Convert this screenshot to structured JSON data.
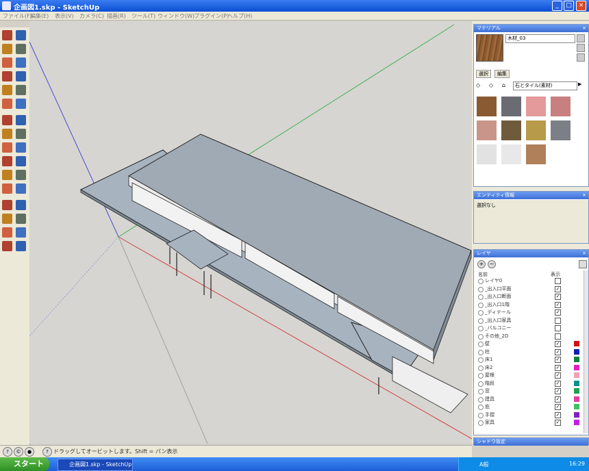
{
  "window": {
    "title": "企画図1.skp - SketchUp",
    "controls": [
      "_",
      "□",
      "×"
    ]
  },
  "menu": [
    "ファイル(F)",
    "編集(E)",
    "表示(V)",
    "カメラ(C)",
    "描画(R)",
    "ツール(T)",
    "ウィンドウ(W)",
    "プラグイン(P)",
    "ヘルプ(H)"
  ],
  "materials_panel": {
    "title": "マテリアル",
    "material_name": "木材_03",
    "tabs": [
      "選択",
      "編集"
    ],
    "category": "石とタイル(素材)",
    "swatch_colors": [
      "#8a5a32",
      "#6b6b74",
      "#e49a9a",
      "#c87f80",
      "#c9958a",
      "#6f5a3c",
      "#b79a4a",
      "#7c7f86",
      "#e2e2e2",
      "#e8e8e8",
      "#b0805a"
    ]
  },
  "entity_panel": {
    "title": "エンティティ情報",
    "value": "選択なし"
  },
  "layers_panel": {
    "title": "レイヤ",
    "col_name": "名前",
    "col_visible": "表示",
    "layers": [
      {
        "name": "レイヤ0",
        "visible": false,
        "color": "#ffffff"
      },
      {
        "name": "_出入口平面",
        "visible": true,
        "color": "#ffffff"
      },
      {
        "name": "_出入口断面",
        "visible": true,
        "color": "#ffffff"
      },
      {
        "name": "_出入口1階",
        "visible": true,
        "color": "#ffffff"
      },
      {
        "name": "_ディテール",
        "visible": true,
        "color": "#ffffff"
      },
      {
        "name": "_出入口家具",
        "visible": false,
        "color": "#ffffff"
      },
      {
        "name": "_バルコニー",
        "visible": false,
        "color": "#ffffff"
      },
      {
        "name": "その他_2D",
        "visible": false,
        "color": "#ffffff"
      },
      {
        "name": "壁",
        "visible": true,
        "color": "#d01010"
      },
      {
        "name": "柱",
        "visible": true,
        "color": "#1020b0"
      },
      {
        "name": "床1",
        "visible": true,
        "color": "#108040"
      },
      {
        "name": "床2",
        "visible": true,
        "color": "#e020c0"
      },
      {
        "name": "屋根",
        "visible": true,
        "color": "#f0a0b0"
      },
      {
        "name": "階段",
        "visible": true,
        "color": "#109090"
      },
      {
        "name": "窓",
        "visible": true,
        "color": "#20a050"
      },
      {
        "name": "建具",
        "visible": true,
        "color": "#e040a0"
      },
      {
        "name": "庇",
        "visible": true,
        "color": "#40c060"
      },
      {
        "name": "手摺",
        "visible": true,
        "color": "#8020c0"
      },
      {
        "name": "家具",
        "visible": true,
        "color": "#c020e0"
      }
    ]
  },
  "bottom_panel": {
    "title": "シャドウ設定"
  },
  "status": {
    "hint": "ドラッグしてオービットします。Shift = パン表示"
  },
  "taskbar": {
    "start": "スタート",
    "task": "企画図1.skp - SketchUp",
    "ime": "A般",
    "clock": "16:29"
  },
  "icons": {
    "toolbar": [
      "select-icon",
      "eraser-icon",
      "paint-bucket-icon",
      "make-component-icon",
      "rectangle-icon",
      "line-icon",
      "circle-icon",
      "arc-icon",
      "polygon-icon",
      "freehand-icon",
      "move-icon",
      "push-pull-icon",
      "rotate-icon",
      "follow-me-icon",
      "scale-icon",
      "offset-icon",
      "tape-measure-icon",
      "dimension-icon",
      "protractor-icon",
      "text-icon",
      "axes-icon",
      "3d-text-icon",
      "orbit-icon",
      "pan-icon",
      "zoom-icon",
      "zoom-window-icon",
      "zoom-extents-icon",
      "previous-view-icon",
      "walk-icon",
      "look-around-icon",
      "position-camera-icon",
      "section-plane-icon"
    ]
  }
}
